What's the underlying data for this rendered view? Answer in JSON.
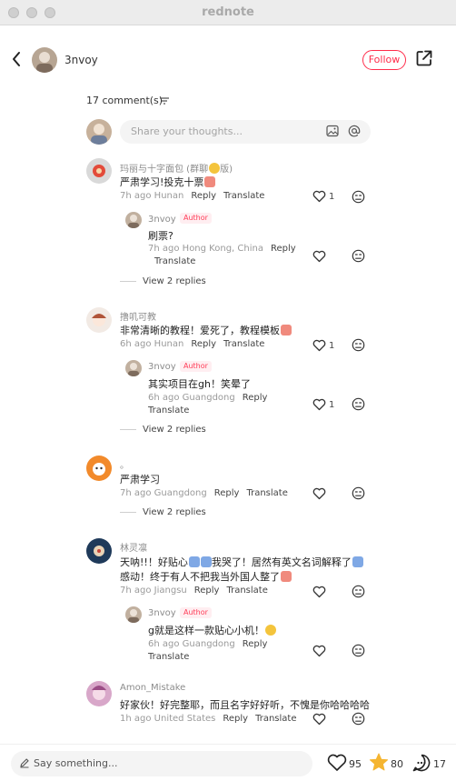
{
  "window": {
    "title": "rednote"
  },
  "header": {
    "author": "3nvoy",
    "follow_label": "Follow"
  },
  "comments_section": {
    "count_label": "17 comment(s)",
    "input_placeholder": "Share your thoughts..."
  },
  "comments": [
    {
      "name": "玛丽与十字面包 (群聊",
      "name_suffix": "版)",
      "text": "严肃学习!投克十票",
      "time": "7h ago",
      "location": "Hunan",
      "reply": "Reply",
      "translate": "Translate",
      "likes": "1"
    },
    {
      "name": "3nvoy",
      "tag": "Author",
      "text": "刷票?",
      "time": "7h ago",
      "location": "Hong Kong, China",
      "reply": "Reply",
      "translate": "Translate",
      "likes": ""
    },
    {
      "view_replies": "View 2 replies"
    },
    {
      "name": "撸叽可教",
      "text": "非常清晰的教程！爱死了，教程模板",
      "time": "6h ago",
      "location": "Hunan",
      "reply": "Reply",
      "translate": "Translate",
      "likes": "1"
    },
    {
      "name": "3nvoy",
      "tag": "Author",
      "text": "其实项目在gh！笑晕了",
      "time": "6h ago",
      "location": "Guangdong",
      "reply": "Reply",
      "translate": "Translate",
      "likes": "1"
    },
    {
      "view_replies": "View 2 replies"
    },
    {
      "name": "。",
      "text": "严肃学习",
      "time": "7h ago",
      "location": "Guangdong",
      "reply": "Reply",
      "translate": "Translate",
      "likes": ""
    },
    {
      "view_replies": "View 2 replies"
    },
    {
      "name": "林灵凛",
      "text": "天呐!!！好贴心",
      "text2": "我哭了！居然有英文名词解释了",
      "text3": "感动！终于有人不把我当外国人整了",
      "time": "7h ago",
      "location": "Jiangsu",
      "reply": "Reply",
      "translate": "Translate",
      "likes": ""
    },
    {
      "name": "3nvoy",
      "tag": "Author",
      "text": "g就是这样一款贴心小机！",
      "time": "6h ago",
      "location": "Guangdong",
      "reply": "Reply",
      "translate": "Translate",
      "likes": ""
    },
    {
      "name": "Amon_Mistake",
      "text": "好家伙！好完整耶，而且名字好好听，不愧是你哈哈哈哈",
      "time": "1h ago",
      "location": "United States",
      "reply": "Reply",
      "translate": "Translate",
      "likes": ""
    }
  ],
  "bottom_bar": {
    "placeholder": "Say something...",
    "likes": "95",
    "stars": "80",
    "comments": "17"
  },
  "colors": {
    "accent": "#ff2d4b",
    "star": "#f5b531"
  },
  "icons": [
    "back-icon",
    "share-icon",
    "filter-icon",
    "image-icon",
    "at-icon",
    "heart-icon",
    "dislike-icon",
    "pen-icon",
    "star-icon",
    "comment-icon"
  ]
}
